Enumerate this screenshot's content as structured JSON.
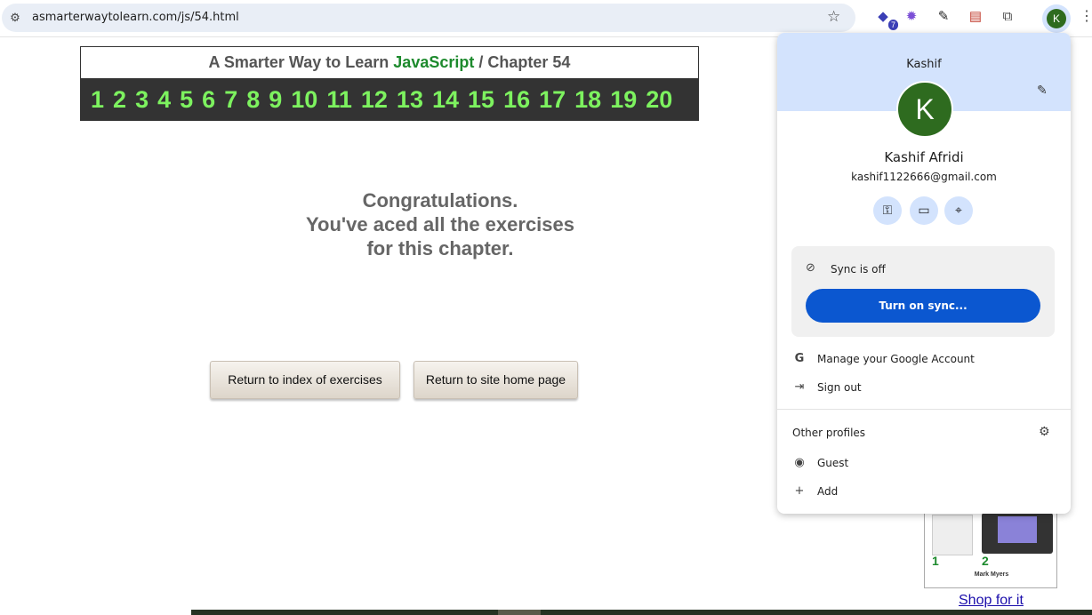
{
  "browser": {
    "url": "asmarterwaytolearn.com/js/54.html",
    "extensions_badge": "7",
    "avatar_letter": "K"
  },
  "page": {
    "header_prefix": "A Smarter Way to Learn",
    "header_brand": "JavaScript",
    "header_sep": "/",
    "header_chapter": "Chapter 54",
    "exercise_numbers": [
      "1",
      "2",
      "3",
      "4",
      "5",
      "6",
      "7",
      "8",
      "9",
      "10",
      "11",
      "12",
      "13",
      "14",
      "15",
      "16",
      "17",
      "18",
      "19",
      "20"
    ],
    "congrats_line1": "Congratulations.",
    "congrats_line2": "You've aced all the exercises",
    "congrats_line3": "for this chapter.",
    "btn_index": "Return to index of exercises",
    "btn_home": "Return to site home page",
    "ad_author": "Mark Myers",
    "ad_num1": "1",
    "ad_num2": "2",
    "shop_link": "Shop for it"
  },
  "profile": {
    "top_name": "Kashif",
    "avatar_letter": "K",
    "full_name": "Kashif Afridi",
    "email": "kashif1122666@gmail.com",
    "sync_status": "Sync is off",
    "sync_button": "Turn on sync...",
    "manage_account": "Manage your Google Account",
    "sign_out": "Sign out",
    "other_profiles": "Other profiles",
    "guest": "Guest",
    "add": "Add"
  },
  "colors": {
    "chapter_bar_bg": "#333333",
    "chapter_numbers": "#7df25f",
    "brand_green": "#1d8a2d",
    "sync_button": "#0b57d0",
    "profile_header": "#d3e3fd",
    "avatar_bg": "#2e6b1f"
  }
}
